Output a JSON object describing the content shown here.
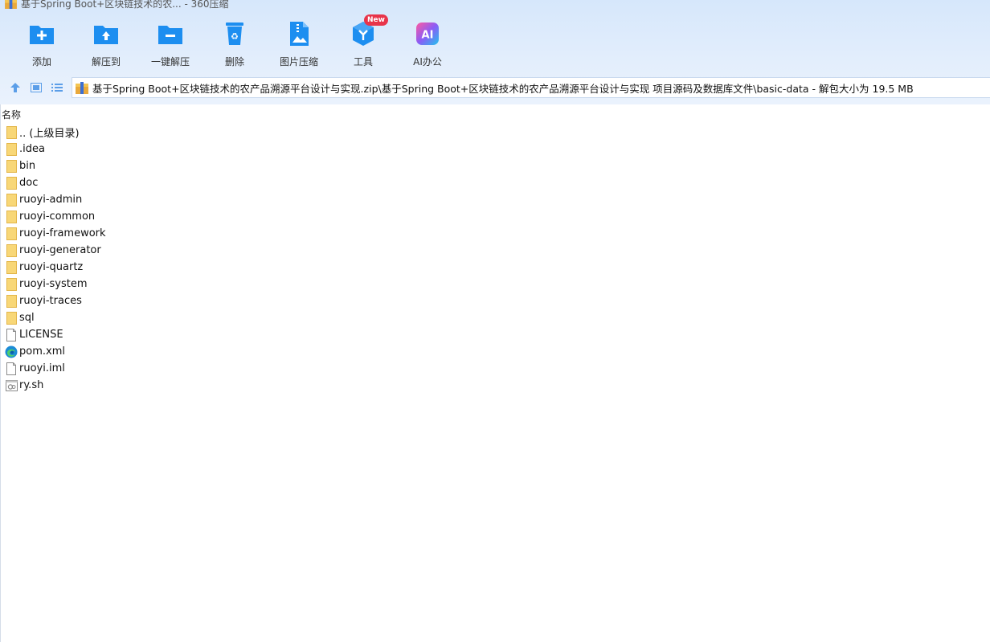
{
  "window": {
    "title": "基于Spring Boot+区块链技术的农... - 360压缩"
  },
  "toolbar": {
    "items": [
      {
        "label": "添加",
        "icon": "add-folder-icon"
      },
      {
        "label": "解压到",
        "icon": "extract-to-icon"
      },
      {
        "label": "一键解压",
        "icon": "one-click-extract-icon"
      },
      {
        "label": "删除",
        "icon": "delete-icon"
      },
      {
        "label": "图片压缩",
        "icon": "image-compress-icon"
      },
      {
        "label": "工具",
        "icon": "tools-icon",
        "badge": "New"
      },
      {
        "label": "AI办公",
        "icon": "ai-office-icon",
        "icon_text": "AI"
      }
    ]
  },
  "address_bar": {
    "path": "基于Spring Boot+区块链技术的农产品溯源平台设计与实现.zip\\基于Spring Boot+区块链技术的农产品溯源平台设计与实现 项目源码及数据库文件\\basic-data - 解包大小为 19.5 MB"
  },
  "file_list": {
    "column_name": "名称",
    "items": [
      {
        "name": ".. (上级目录)",
        "type": "folder"
      },
      {
        "name": ".idea",
        "type": "folder"
      },
      {
        "name": "bin",
        "type": "folder"
      },
      {
        "name": "doc",
        "type": "folder"
      },
      {
        "name": "ruoyi-admin",
        "type": "folder"
      },
      {
        "name": "ruoyi-common",
        "type": "folder"
      },
      {
        "name": "ruoyi-framework",
        "type": "folder"
      },
      {
        "name": "ruoyi-generator",
        "type": "folder"
      },
      {
        "name": "ruoyi-quartz",
        "type": "folder"
      },
      {
        "name": "ruoyi-system",
        "type": "folder"
      },
      {
        "name": "ruoyi-traces",
        "type": "folder"
      },
      {
        "name": "sql",
        "type": "folder"
      },
      {
        "name": "LICENSE",
        "type": "file"
      },
      {
        "name": "pom.xml",
        "type": "edge"
      },
      {
        "name": "ruoyi.iml",
        "type": "file"
      },
      {
        "name": "ry.sh",
        "type": "script"
      }
    ]
  },
  "colors": {
    "accent": "#1d8ef0",
    "folder": "#f8d777",
    "badge": "#e8344a"
  }
}
